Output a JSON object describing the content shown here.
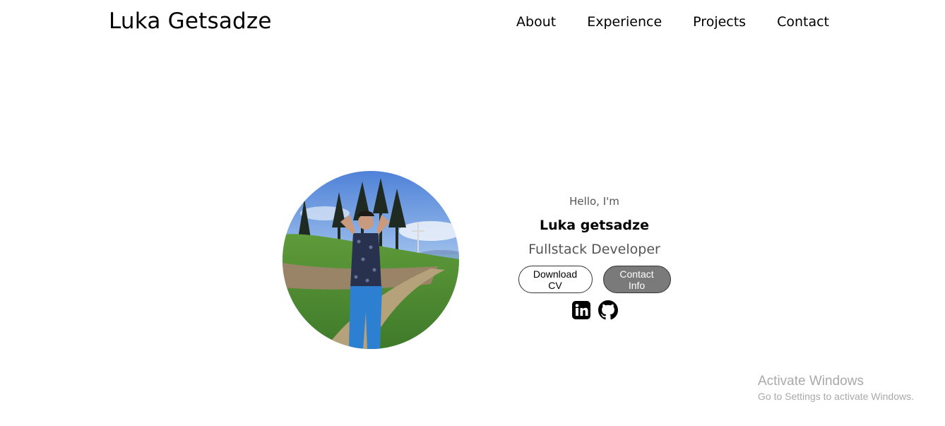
{
  "header": {
    "logo": "Luka Getsadze",
    "nav": [
      "About",
      "Experience",
      "Projects",
      "Contact"
    ]
  },
  "profile": {
    "greeting": "Hello, I'm",
    "name": "Luka getsadze",
    "role": "Fullstack Developer",
    "buttons": {
      "download_cv": "Download CV",
      "contact_info": "Contact Info"
    },
    "socials": [
      "linkedin-icon",
      "github-icon"
    ]
  },
  "watermark": {
    "title": "Activate Windows",
    "subtitle": "Go to Settings to activate Windows."
  },
  "colors": {
    "filled_button": "#7a7a7a",
    "muted_text": "#555555",
    "watermark": "#a9a9a9"
  }
}
